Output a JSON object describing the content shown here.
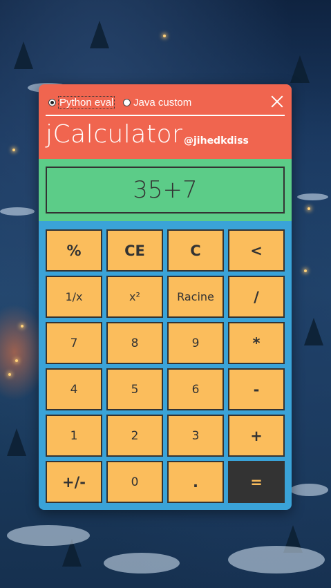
{
  "mode": {
    "options": [
      {
        "label": "Python eval",
        "checked": true
      },
      {
        "label": "Java custom",
        "checked": false
      }
    ]
  },
  "header": {
    "title": "jCalculator",
    "handle": "@jihedkdiss",
    "close_icon": "close-icon"
  },
  "display": {
    "value": "35+7"
  },
  "keys": [
    {
      "label": "%",
      "style": "bold"
    },
    {
      "label": "CE",
      "style": "bold"
    },
    {
      "label": "C",
      "style": "bold"
    },
    {
      "label": "<",
      "style": "bold"
    },
    {
      "label": "1/x",
      "style": "small"
    },
    {
      "label": "x²",
      "style": "small"
    },
    {
      "label": "Racine",
      "style": "small"
    },
    {
      "label": "/",
      "style": "bold"
    },
    {
      "label": "7",
      "style": "normal"
    },
    {
      "label": "8",
      "style": "normal"
    },
    {
      "label": "9",
      "style": "normal"
    },
    {
      "label": "*",
      "style": "bold"
    },
    {
      "label": "4",
      "style": "normal"
    },
    {
      "label": "5",
      "style": "normal"
    },
    {
      "label": "6",
      "style": "normal"
    },
    {
      "label": "-",
      "style": "bold"
    },
    {
      "label": "1",
      "style": "normal"
    },
    {
      "label": "2",
      "style": "normal"
    },
    {
      "label": "3",
      "style": "normal"
    },
    {
      "label": "+",
      "style": "bold"
    },
    {
      "label": "+/-",
      "style": "bold"
    },
    {
      "label": "0",
      "style": "normal"
    },
    {
      "label": ".",
      "style": "bold"
    },
    {
      "label": "=",
      "style": "equals"
    }
  ],
  "colors": {
    "header": "#f0654f",
    "display_bg": "#5ccc88",
    "keypad_bg": "#3aa3d8",
    "key": "#fbbd5c",
    "equals_key": "#333333"
  }
}
